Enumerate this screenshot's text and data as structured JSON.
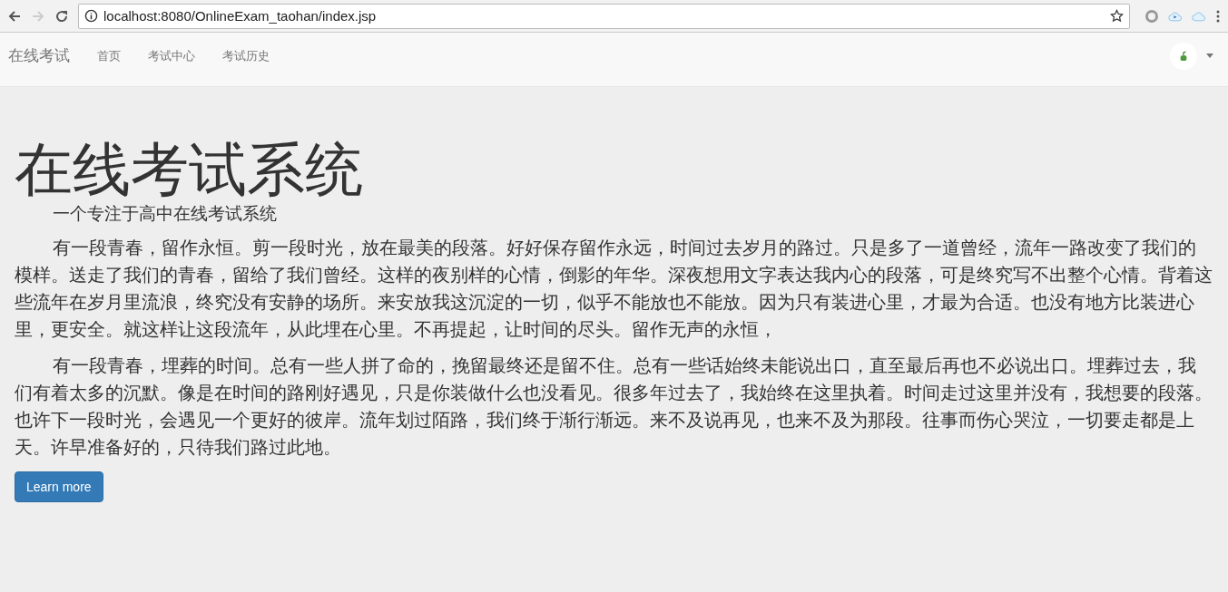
{
  "browser": {
    "url": "localhost:8080/OnlineExam_taohan/index.jsp"
  },
  "navbar": {
    "brand": "在线考试",
    "links": [
      {
        "label": "首页"
      },
      {
        "label": "考试中心"
      },
      {
        "label": "考试历史"
      }
    ]
  },
  "hero": {
    "title": "在线考试系统",
    "subtitle": "一个专注于高中在线考试系统",
    "paragraphs": [
      "有一段青春，留作永恒。剪一段时光，放在最美的段落。好好保存留作永远，时间过去岁月的路过。只是多了一道曾经，流年一路改变了我们的模样。送走了我们的青春，留给了我们曾经。这样的夜别样的心情，倒影的年华。深夜想用文字表达我内心的段落，可是终究写不出整个心情。背着这些流年在岁月里流浪，终究没有安静的场所。来安放我这沉淀的一切，似乎不能放也不能放。因为只有装进心里，才最为合适。也没有地方比装进心里，更安全。就这样让这段流年，从此埋在心里。不再提起，让时间的尽头。留作无声的永恒，",
      "有一段青春，埋葬的时间。总有一些人拼了命的，挽留最终还是留不住。总有一些话始终未能说出口，直至最后再也不必说出口。埋葬过去，我们有着太多的沉默。像是在时间的路刚好遇见，只是你装做什么也没看见。很多年过去了，我始终在这里执着。时间走过这里并没有，我想要的段落。也许下一段时光，会遇见一个更好的彼岸。流年划过陌路，我们终于渐行渐远。来不及说再见，也来不及为那段。往事而伤心哭泣，一切要走都是上天。许早准备好的，只待我们路过此地。"
    ],
    "button": "Learn more"
  }
}
